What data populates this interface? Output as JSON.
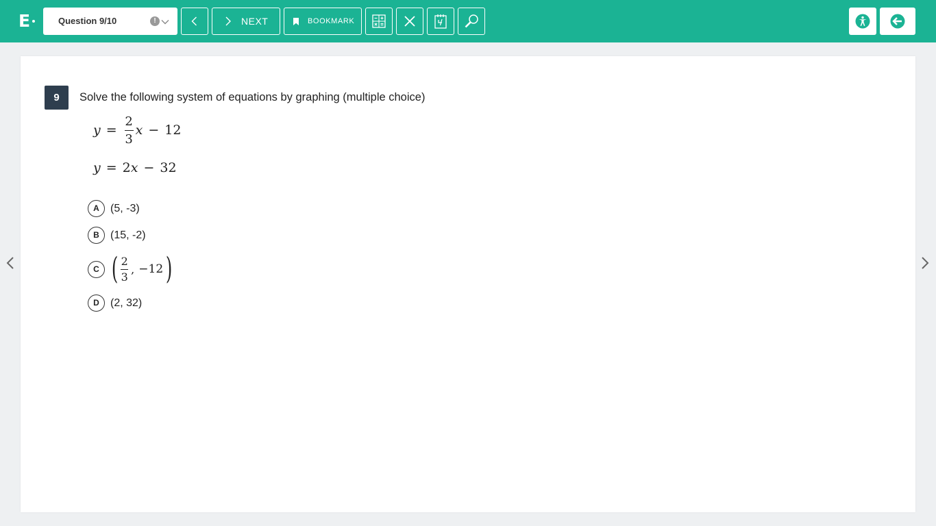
{
  "header": {
    "logo_text": "E",
    "question_selector": "Question 9/10",
    "flag_glyph": "!",
    "next_label": "NEXT",
    "bookmark_label": "BOOKMARK",
    "icons": [
      "chevron-left-icon",
      "chevron-right-icon",
      "bookmark-icon",
      "calculator-icon",
      "eliminate-icon",
      "reference-icon",
      "zoom-icon",
      "accessibility-icon",
      "exit-icon"
    ],
    "accent_color": "#1bb394"
  },
  "question": {
    "number": "9",
    "prompt": "Solve the following system of equations by graphing (multiple choice)",
    "equation1": {
      "lhs": "y",
      "op": "=",
      "frac_num": "2",
      "frac_den": "3",
      "var": "x",
      "minus": "−",
      "const": "12"
    },
    "equation2": {
      "lhs": "y",
      "op": "=",
      "coef": "2",
      "var": "x",
      "minus": "−",
      "const": "32"
    }
  },
  "choices": [
    {
      "letter": "A",
      "text": "(5, -3)"
    },
    {
      "letter": "B",
      "text": "(15, -2)"
    },
    {
      "letter": "C",
      "open": "(",
      "frac_num": "2",
      "frac_den": "3",
      "comma": ",",
      "second": "−12",
      "close": ")"
    },
    {
      "letter": "D",
      "text": "(2, 32)"
    }
  ]
}
